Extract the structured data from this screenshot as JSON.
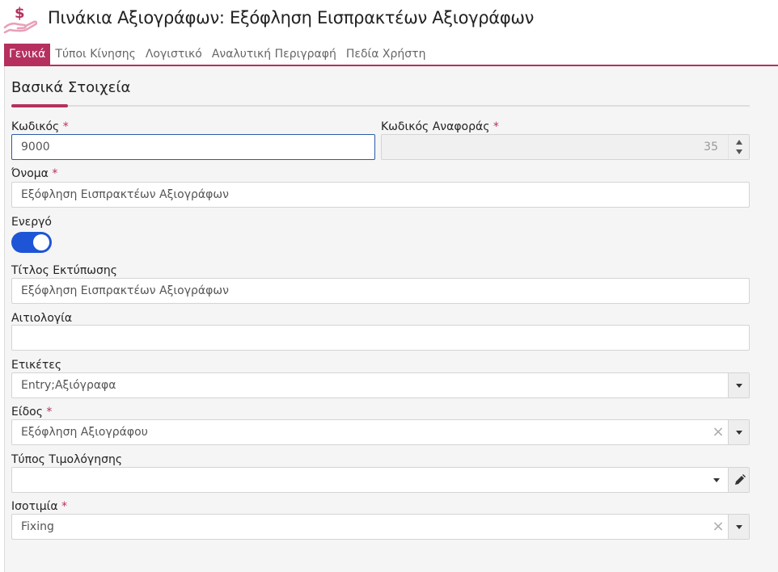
{
  "header": {
    "title": "Πινάκια Αξιογράφων: Εξόφληση Εισπρακτέων Αξιογράφων",
    "icon": "hand-dollar-icon",
    "accent": "#b5305f"
  },
  "tabs": [
    {
      "label": "Γενικά",
      "active": true
    },
    {
      "label": "Τύποι Κίνησης",
      "active": false
    },
    {
      "label": "Λογιστικό",
      "active": false
    },
    {
      "label": "Αναλυτική Περιγραφή",
      "active": false
    },
    {
      "label": "Πεδία Χρήστη",
      "active": false
    }
  ],
  "section": {
    "title": "Βασικά Στοιχεία"
  },
  "fields": {
    "code": {
      "label": "Κωδικός",
      "value": "9000"
    },
    "ref_code": {
      "label": "Κωδικός Αναφοράς",
      "value": "35"
    },
    "name": {
      "label": "Όνομα",
      "value": "Εξόφληση Εισπρακτέων Αξιογράφων"
    },
    "active": {
      "label": "Ενεργό",
      "value": true
    },
    "print_title": {
      "label": "Τίτλος Εκτύπωσης",
      "value": "Εξόφληση Εισπρακτέων Αξιογράφων"
    },
    "reason": {
      "label": "Αιτιολογία",
      "value": ""
    },
    "tags": {
      "label": "Ετικέτες",
      "value": "Entry;Αξιόγραφα"
    },
    "kind": {
      "label": "Είδος",
      "value": "Εξόφληση Αξιογράφου"
    },
    "invoice_type": {
      "label": "Τύπος Τιμολόγησης",
      "value": ""
    },
    "parity": {
      "label": "Ισοτιμία",
      "value": "Fixing"
    }
  },
  "required_mark": "*"
}
